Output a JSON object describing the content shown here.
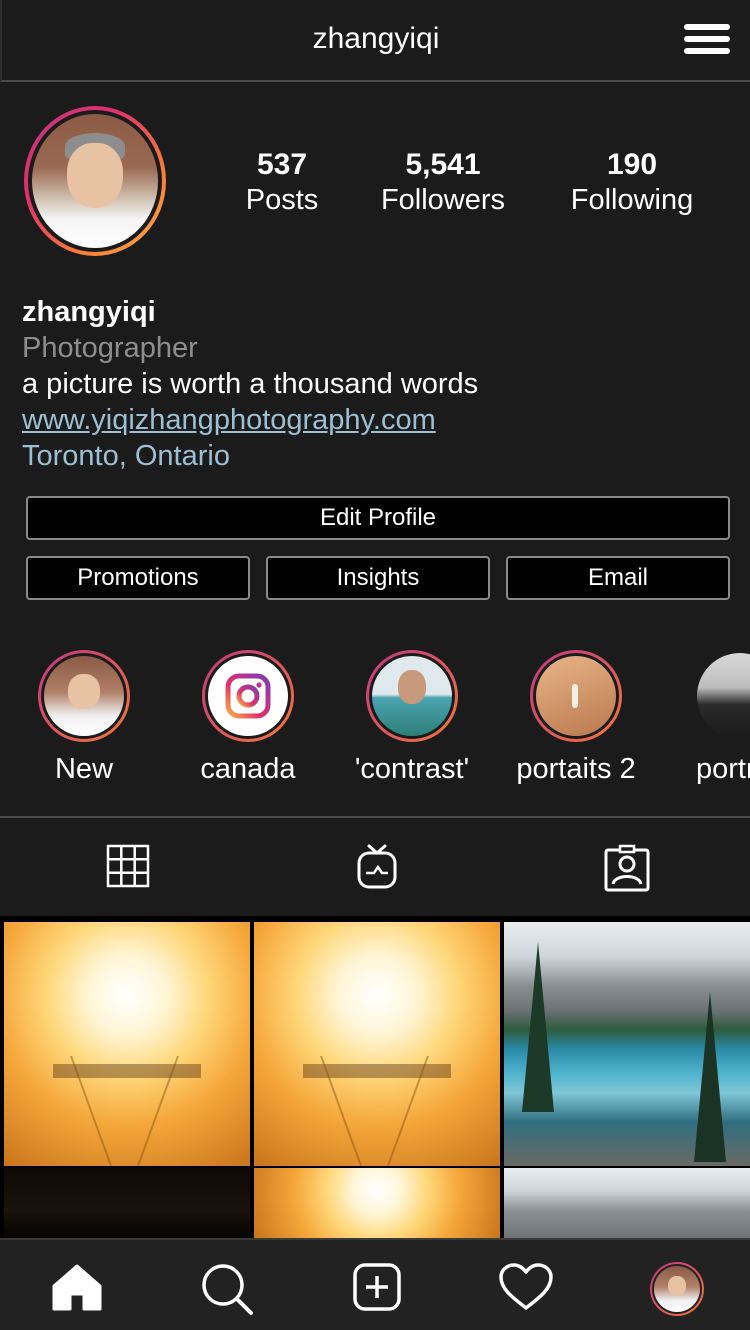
{
  "header": {
    "title": "zhangyiqi",
    "menu_icon": "hamburger-menu-icon"
  },
  "profile": {
    "stats": [
      {
        "value": "537",
        "label": "Posts"
      },
      {
        "value": "5,541",
        "label": "Followers"
      },
      {
        "value": "190",
        "label": "Following"
      }
    ],
    "name": "zhangyiqi",
    "category": "Photographer",
    "bio": "a picture is worth a thousand words",
    "website": "www.yiqizhangphotography.com",
    "location": "Toronto, Ontario"
  },
  "buttons": {
    "edit_profile": "Edit Profile",
    "promotions": "Promotions",
    "insights": "Insights",
    "email": "Email"
  },
  "highlights": [
    {
      "label": "New"
    },
    {
      "label": "canada"
    },
    {
      "label": "'contrast'"
    },
    {
      "label": "portaits 2"
    },
    {
      "label": "portr"
    }
  ],
  "tabs": [
    "grid-icon",
    "igtv-icon",
    "tagged-icon"
  ],
  "bottom_nav": [
    "home-icon",
    "search-icon",
    "add-post-icon",
    "activity-heart-icon",
    "profile-avatar"
  ],
  "colors": {
    "background": "#1b1b1b",
    "link": "#9bbfd4",
    "muted": "#8e8e8e",
    "ring_start": "#c13584",
    "ring_end": "#f77737"
  }
}
